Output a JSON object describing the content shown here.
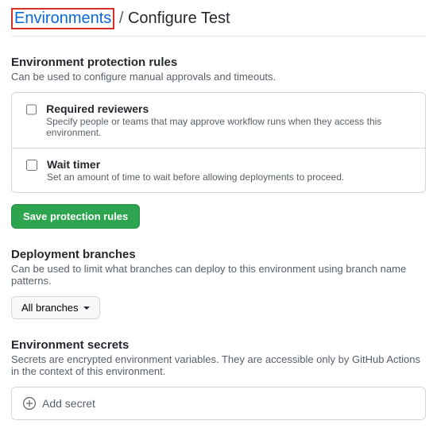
{
  "breadcrumb": {
    "link": "Environments",
    "separator": "/",
    "current": "Configure Test"
  },
  "protection": {
    "title": "Environment protection rules",
    "desc": "Can be used to configure manual approvals and timeouts.",
    "rules": [
      {
        "label": "Required reviewers",
        "desc": "Specify people or teams that may approve workflow runs when they access this environment.",
        "checked": false
      },
      {
        "label": "Wait timer",
        "desc": "Set an amount of time to wait before allowing deployments to proceed.",
        "checked": false
      }
    ],
    "save_label": "Save protection rules"
  },
  "branches": {
    "title": "Deployment branches",
    "desc": "Can be used to limit what branches can deploy to this environment using branch name patterns.",
    "selected": "All branches"
  },
  "secrets": {
    "title": "Environment secrets",
    "desc": "Secrets are encrypted environment variables. They are accessible only by GitHub Actions in the context of this environment.",
    "add_label": "Add secret"
  }
}
